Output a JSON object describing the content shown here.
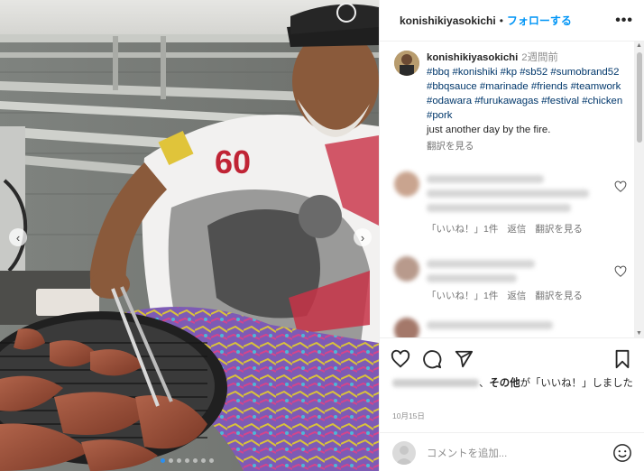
{
  "post": {
    "username": "konishikiyasokichi",
    "separator": "•",
    "follow_label": "フォローする",
    "more_label": "•••"
  },
  "caption": {
    "author": "konishikiyasokichi",
    "time": "2週間前",
    "tags": "#bbq #konishiki #kp #sb52 #sumobrand52 #bbqsauce #marinade #friends #teamwork #odawara #furukawagas #festival #chicken #pork",
    "text": "just another day by the fire.",
    "translate": "翻訳を見る"
  },
  "comments": [
    {
      "likes": "「いいね！」1件",
      "reply": "返信",
      "translate": "翻訳を見る"
    },
    {
      "likes": "「いいね！」1件",
      "reply": "返信",
      "translate": "翻訳を見る"
    }
  ],
  "likes_text": {
    "suffix_bold": "その他",
    "suffix": "が「いいね！」しました"
  },
  "date": "10月15日",
  "comment_box": {
    "placeholder": "コメントを追加..."
  },
  "icons": {
    "like": "heart-icon",
    "comment": "comment-icon",
    "share": "share-icon",
    "save": "bookmark-icon",
    "emoji": "emoji-icon",
    "more": "more-icon"
  },
  "colors": {
    "link": "#0095f6",
    "hashtag": "#00376b",
    "carousel_active": "#2b8ff0"
  }
}
